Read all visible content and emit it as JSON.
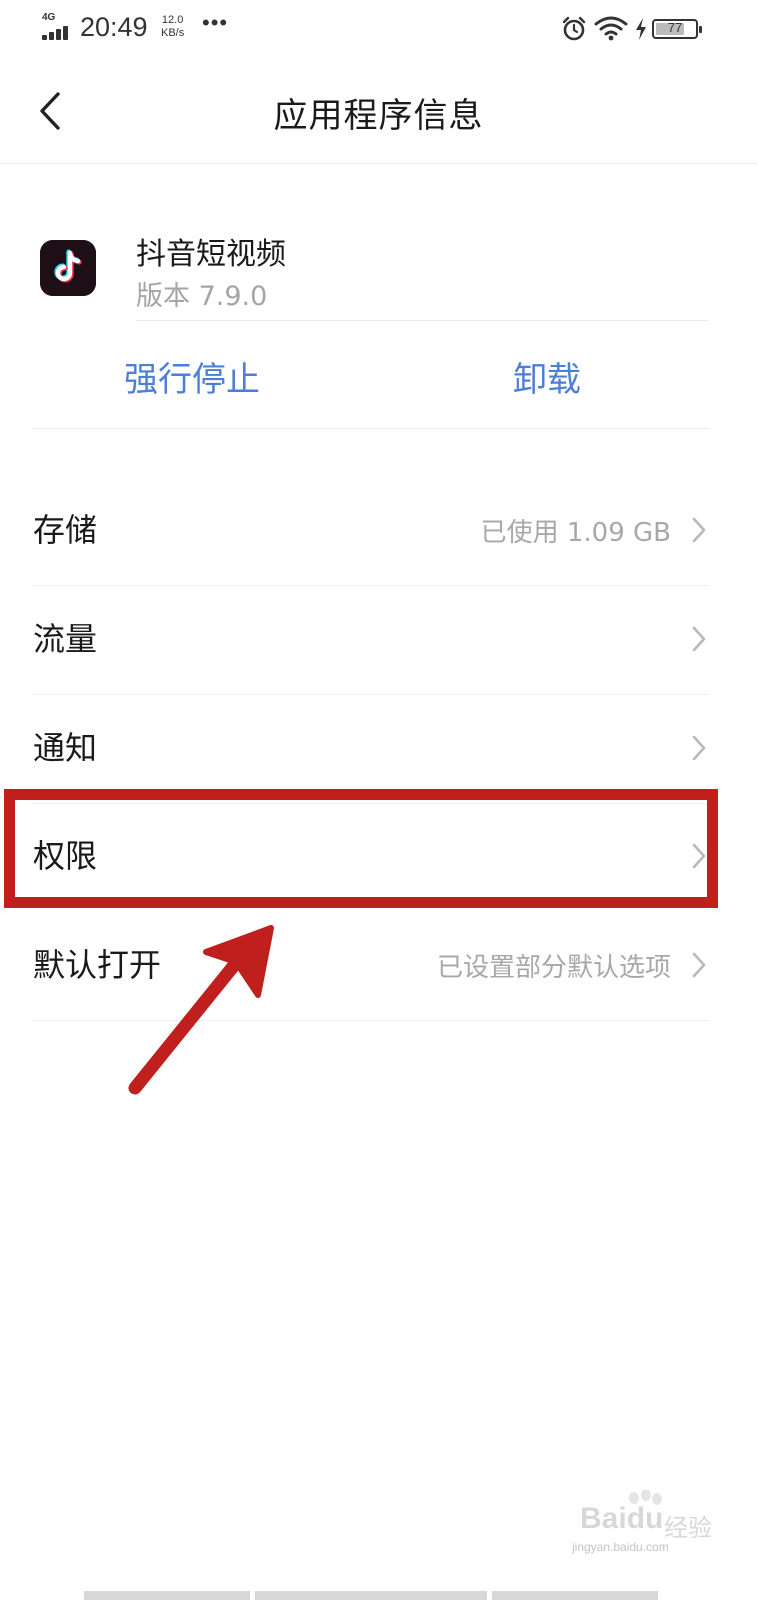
{
  "status_bar": {
    "network": "4G",
    "time": "20:49",
    "speed_value": "12.0",
    "speed_unit": "KB/s",
    "more": "•••",
    "battery_level": 77,
    "battery_text": "77",
    "icons": [
      "alarm-icon",
      "wifi-icon",
      "charging-icon",
      "battery-icon"
    ]
  },
  "header": {
    "title": "应用程序信息"
  },
  "app": {
    "name": "抖音短视频",
    "version": "版本 7.9.0",
    "icon": "tiktok-logo"
  },
  "actions": {
    "force_stop": "强行停止",
    "uninstall": "卸载"
  },
  "rows": [
    {
      "label": "存储",
      "value": "已使用 1.09 GB"
    },
    {
      "label": "流量",
      "value": ""
    },
    {
      "label": "通知",
      "value": ""
    },
    {
      "label": "权限",
      "value": ""
    },
    {
      "label": "默认打开",
      "value": "已设置部分默认选项"
    }
  ],
  "watermark": {
    "brand": "Bai",
    "brand2": "du",
    "cn": "经验",
    "url": "jingyan.baidu.com"
  },
  "colors": {
    "accent": "#4e7fd6",
    "highlight": "#c0201d",
    "secondary_text": "#a8a8a8"
  }
}
